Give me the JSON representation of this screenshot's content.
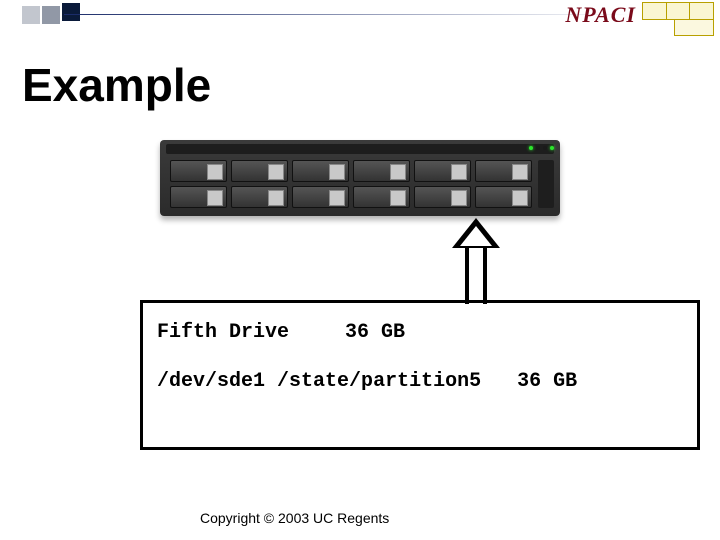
{
  "header": {
    "logo_text": "NPACI"
  },
  "title": "Example",
  "drive": {
    "label": "Fifth Drive",
    "capacity": "36 GB",
    "device": "/dev/sde1",
    "mount": "/state/partition5",
    "size": "36 GB"
  },
  "footer": {
    "copyright": "Copyright © 2003 UC Regents"
  }
}
